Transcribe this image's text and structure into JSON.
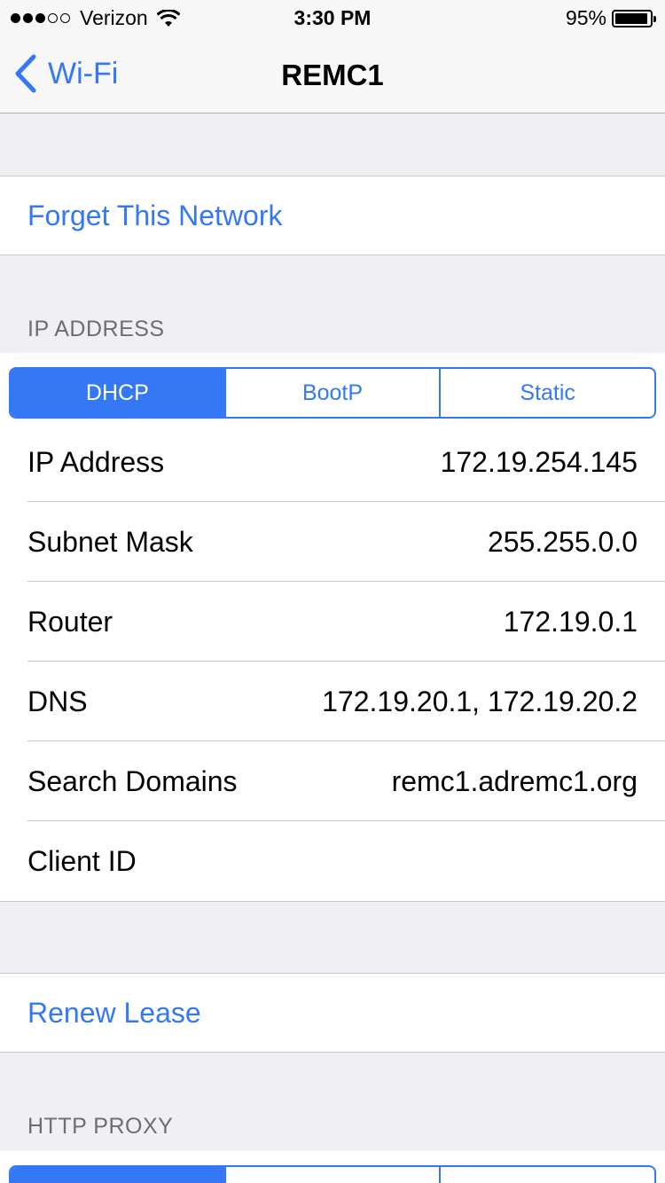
{
  "status_bar": {
    "carrier": "Verizon",
    "time": "3:30 PM",
    "battery": "95%",
    "battery_level": 0.95,
    "signal_bars_filled": 3,
    "signal_bars_total": 5
  },
  "nav": {
    "back_label": "Wi-Fi",
    "title": "REMC1"
  },
  "actions": {
    "forget": "Forget This Network",
    "renew": "Renew Lease"
  },
  "ip_section": {
    "header": "IP ADDRESS",
    "segments": [
      "DHCP",
      "BootP",
      "Static"
    ],
    "selected": "DHCP",
    "rows": [
      {
        "label": "IP Address",
        "value": "172.19.254.145"
      },
      {
        "label": "Subnet Mask",
        "value": "255.255.0.0"
      },
      {
        "label": "Router",
        "value": "172.19.0.1"
      },
      {
        "label": "DNS",
        "value": "172.19.20.1, 172.19.20.2"
      },
      {
        "label": "Search Domains",
        "value": "remc1.adremc1.org"
      },
      {
        "label": "Client ID",
        "value": ""
      }
    ]
  },
  "proxy_section": {
    "header": "HTTP PROXY"
  },
  "colors": {
    "accent": "#3478f6",
    "background": "#efeff4",
    "separator": "#c8c7cc"
  }
}
